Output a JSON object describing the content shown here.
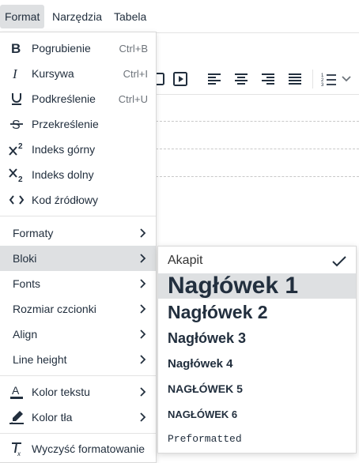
{
  "menubar": {
    "items": [
      {
        "label": "Format",
        "active": true
      },
      {
        "label": "Narzędzia",
        "active": false
      },
      {
        "label": "Tabela",
        "active": false
      }
    ]
  },
  "toolbar": {
    "icons": [
      "media-icon",
      "align-left-icon",
      "align-center-icon",
      "align-right-icon",
      "justify-icon",
      "numbered-list-icon",
      "chevron-down-icon"
    ]
  },
  "format_menu": {
    "items": [
      {
        "label": "Pogrubienie",
        "shortcut": "Ctrl+B",
        "icon": "bold-icon"
      },
      {
        "label": "Kursywa",
        "shortcut": "Ctrl+I",
        "icon": "italic-icon"
      },
      {
        "label": "Podkreślenie",
        "shortcut": "Ctrl+U",
        "icon": "underline-icon"
      },
      {
        "label": "Przekreślenie",
        "shortcut": "",
        "icon": "strikethrough-icon"
      },
      {
        "label": "Indeks górny",
        "shortcut": "",
        "icon": "superscript-icon"
      },
      {
        "label": "Indeks dolny",
        "shortcut": "",
        "icon": "subscript-icon"
      },
      {
        "label": "Kod źródłowy",
        "shortcut": "",
        "icon": "code-icon"
      }
    ],
    "submenus": [
      {
        "label": "Formaty"
      },
      {
        "label": "Bloki",
        "highlighted": true
      },
      {
        "label": "Fonts"
      },
      {
        "label": "Rozmiar czcionki"
      },
      {
        "label": "Align"
      },
      {
        "label": "Line height"
      }
    ],
    "colors": [
      {
        "label": "Kolor tekstu",
        "icon": "text-color-icon"
      },
      {
        "label": "Kolor tła",
        "icon": "highlight-color-icon"
      }
    ],
    "clear": {
      "label": "Wyczyść formatowanie",
      "icon": "clear-formatting-icon"
    }
  },
  "blocks_menu": {
    "items": [
      {
        "label": "Akapit",
        "checked": true
      },
      {
        "label": "Nagłówek 1",
        "highlighted": true
      },
      {
        "label": "Nagłówek 2"
      },
      {
        "label": "Nagłówek 3"
      },
      {
        "label": "Nagłówek 4"
      },
      {
        "label": "NAGŁÓWEK 5"
      },
      {
        "label": "NAGŁÓWEK 6"
      },
      {
        "label": "Preformatted"
      }
    ]
  },
  "colors": {
    "text": "#222f3e",
    "highlight": "#dee0e2",
    "border": "#d9d9d9"
  }
}
